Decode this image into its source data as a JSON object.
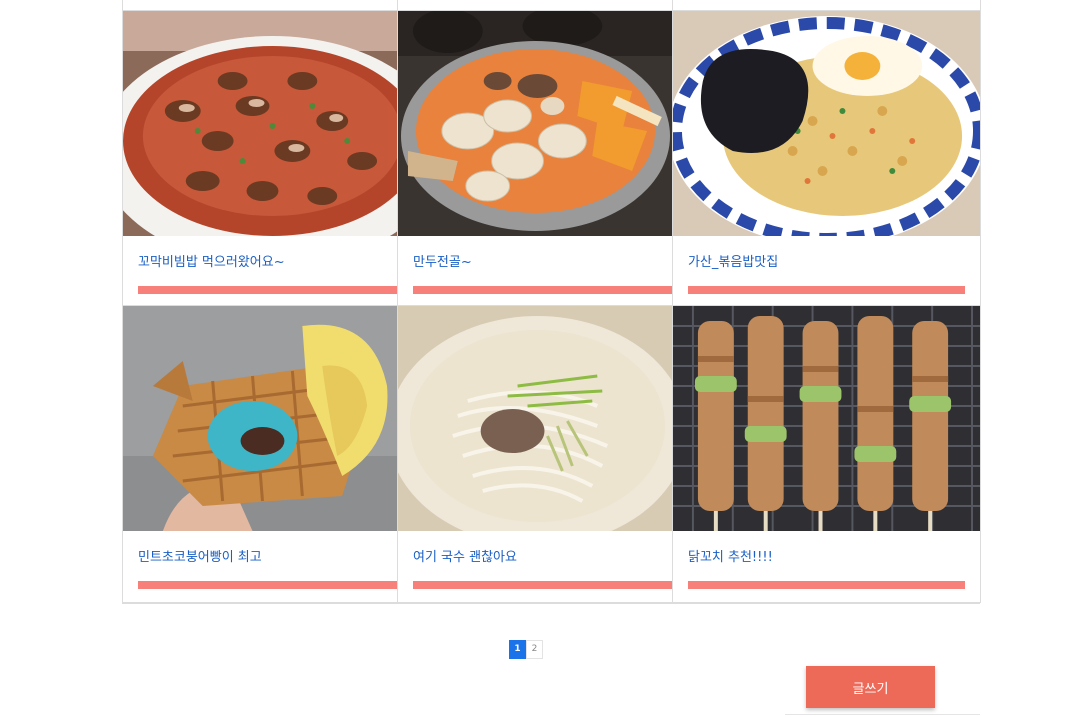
{
  "posts": [
    {
      "title": "꼬막비빔밥 먹으러왔어요~",
      "image": "spicy-cockle-dish-photo"
    },
    {
      "title": "만두전골~",
      "image": "dumpling-hotpot-photo"
    },
    {
      "title": "가산_볶음밥맛집",
      "image": "fried-rice-jjajang-photo"
    },
    {
      "title": "민트초코붕어빵이 최고",
      "image": "mint-choco-fish-bread-photo"
    },
    {
      "title": "여기 국수 괜찮아요",
      "image": "noodle-soup-photo"
    },
    {
      "title": "닭꼬치 추천!!!!",
      "image": "chicken-skewers-photo"
    }
  ],
  "colors": {
    "title_link": "#1a5fc4",
    "accent_bar": "#f7807a",
    "write_button": "#ee6a58",
    "page_active": "#1a73e8"
  },
  "pagination": {
    "pages": [
      "1",
      "2"
    ],
    "current": "1"
  },
  "write_button_label": "글쓰기"
}
